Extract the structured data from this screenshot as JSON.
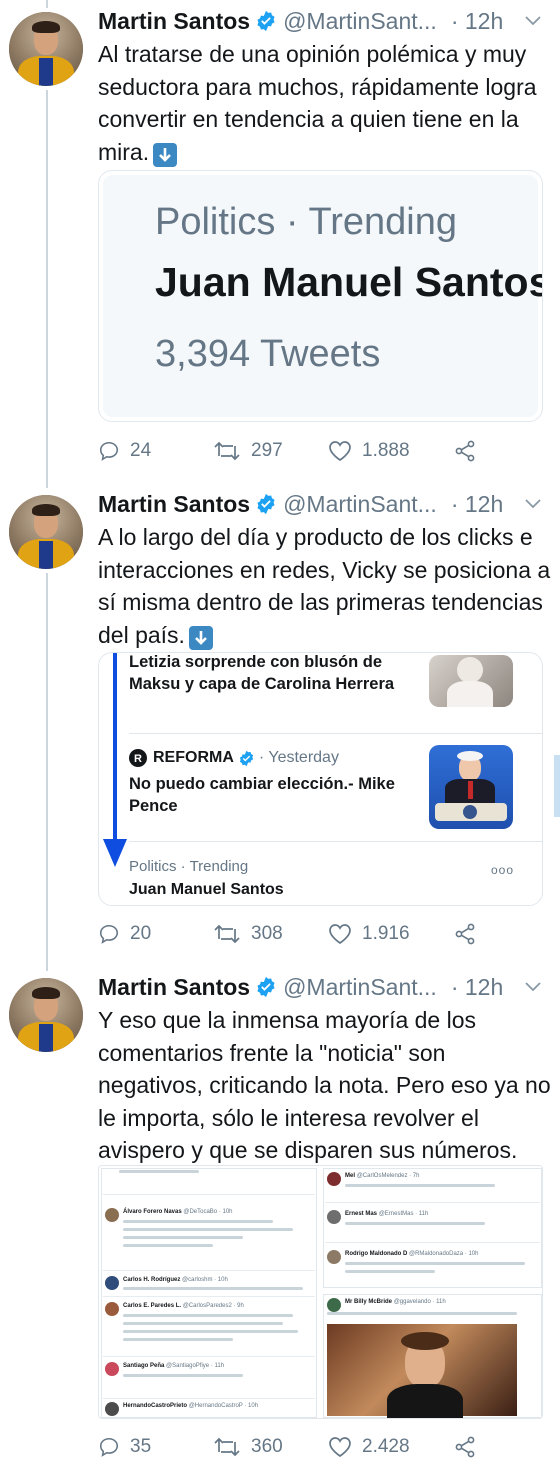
{
  "colors": {
    "verified": "#1da1f2",
    "muted": "#657786",
    "text": "#14171a",
    "emoji_arrow": "#3b88c3",
    "annotation_arrow": "#0f4de0"
  },
  "tweets": [
    {
      "author": {
        "name": "Martin Santos",
        "handle": "@MartinSant...",
        "time": "· 12h"
      },
      "text": "Al tratarse de una opinión polémica y muy seductora para muchos, rápidamente logra convertir en tendencia a quien tiene en la mira.",
      "actions": {
        "replies": "24",
        "retweets": "297",
        "likes": "1.888"
      },
      "card": {
        "category": "Politics · Trending",
        "topic": "Juan Manuel Santos",
        "count": "3,394 Tweets"
      }
    },
    {
      "author": {
        "name": "Martin Santos",
        "handle": "@MartinSant...",
        "time": "· 12h"
      },
      "text": "A lo largo del día y producto de los clicks e interacciones en redes, Vicky se posiciona a sí misma dentro de las primeras tendencias del país.",
      "actions": {
        "replies": "20",
        "retweets": "308",
        "likes": "1.916"
      },
      "card": {
        "item1_headline": "Letizia sorprende con blusón de Maksu y capa de Carolina Herrera",
        "item2_source": "REFORMA",
        "item2_time": "· Yesterday",
        "item2_headline": "No puedo cambiar elección.- Mike Pence",
        "trend_category": "Politics · Trending",
        "trend_topic": "Juan Manuel Santos",
        "more": "ooo"
      }
    },
    {
      "author": {
        "name": "Martin Santos",
        "handle": "@MartinSant...",
        "time": "· 12h"
      },
      "text": "Y eso que la inmensa mayoría de los comentarios frente la \"noticia\" son negativos, criticando la nota. Pero eso ya no le importa, sólo le interesa revolver el avispero y que se disparen sus números.",
      "actions": {
        "replies": "35",
        "retweets": "360",
        "likes": "2.428"
      },
      "card": {
        "left": [
          {
            "name": "Álvaro Forero Navas",
            "meta": "@DeTocaBo · 10h"
          },
          {
            "name": "Carlos H. Rodríguez",
            "meta": "@carloshm · 10h"
          },
          {
            "name": "Carlos E. Paredes L.",
            "meta": "@CarlosParedes2 · 9h"
          },
          {
            "name": "Santiago Peña",
            "meta": "@SantiagoPfiye · 11h"
          },
          {
            "name": "HernandoCastroPrieto",
            "meta": "@HernandoCastroP · 10h"
          }
        ],
        "right": [
          {
            "name": "Mel",
            "meta": "@CarlOsMelendez · 7h"
          },
          {
            "name": "Ernest Mas",
            "meta": "@ErnestMas · 11h"
          },
          {
            "name": "Rodrigo Maldonado D",
            "meta": "@RMaldonadoDaza · 10h"
          },
          {
            "name": "Mr Billy McBride",
            "meta": "@ggavelando · 11h"
          }
        ]
      }
    }
  ]
}
